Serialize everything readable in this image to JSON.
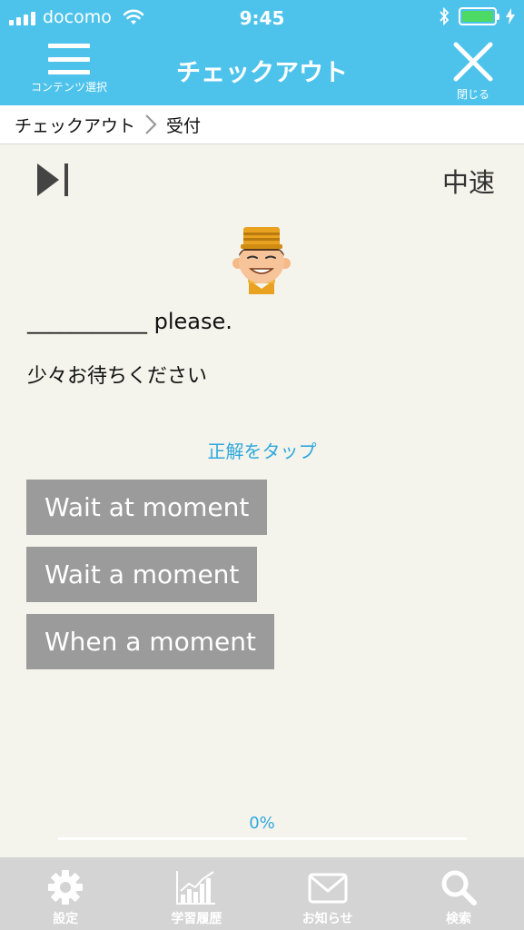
{
  "status_bar": {
    "carrier": "docomo",
    "time": "9:45"
  },
  "nav": {
    "menu_label": "コンテンツ選択",
    "title": "チェックアウト",
    "close_label": "閉じる"
  },
  "breadcrumb": {
    "items": [
      "チェックアウト",
      "受付"
    ]
  },
  "player": {
    "speed": "中速"
  },
  "question": {
    "sentence": "___________ please.",
    "translation": "少々お待ちください",
    "instruction": "正解をタップ"
  },
  "answers": [
    {
      "label": "Wait at moment"
    },
    {
      "label": "Wait a moment"
    },
    {
      "label": "When a moment"
    }
  ],
  "progress": {
    "label": "0%",
    "value": 0
  },
  "tabs": [
    {
      "label": "設定",
      "icon": "gear-icon"
    },
    {
      "label": "学習履歴",
      "icon": "chart-icon"
    },
    {
      "label": "お知らせ",
      "icon": "envelope-icon"
    },
    {
      "label": "検索",
      "icon": "search-icon"
    }
  ],
  "colors": {
    "accent": "#4dc3ec",
    "link": "#2fa8dd",
    "answer_bg": "#9b9b9b",
    "background": "#f4f4ec",
    "tabbar_bg": "#d4d4d4"
  }
}
